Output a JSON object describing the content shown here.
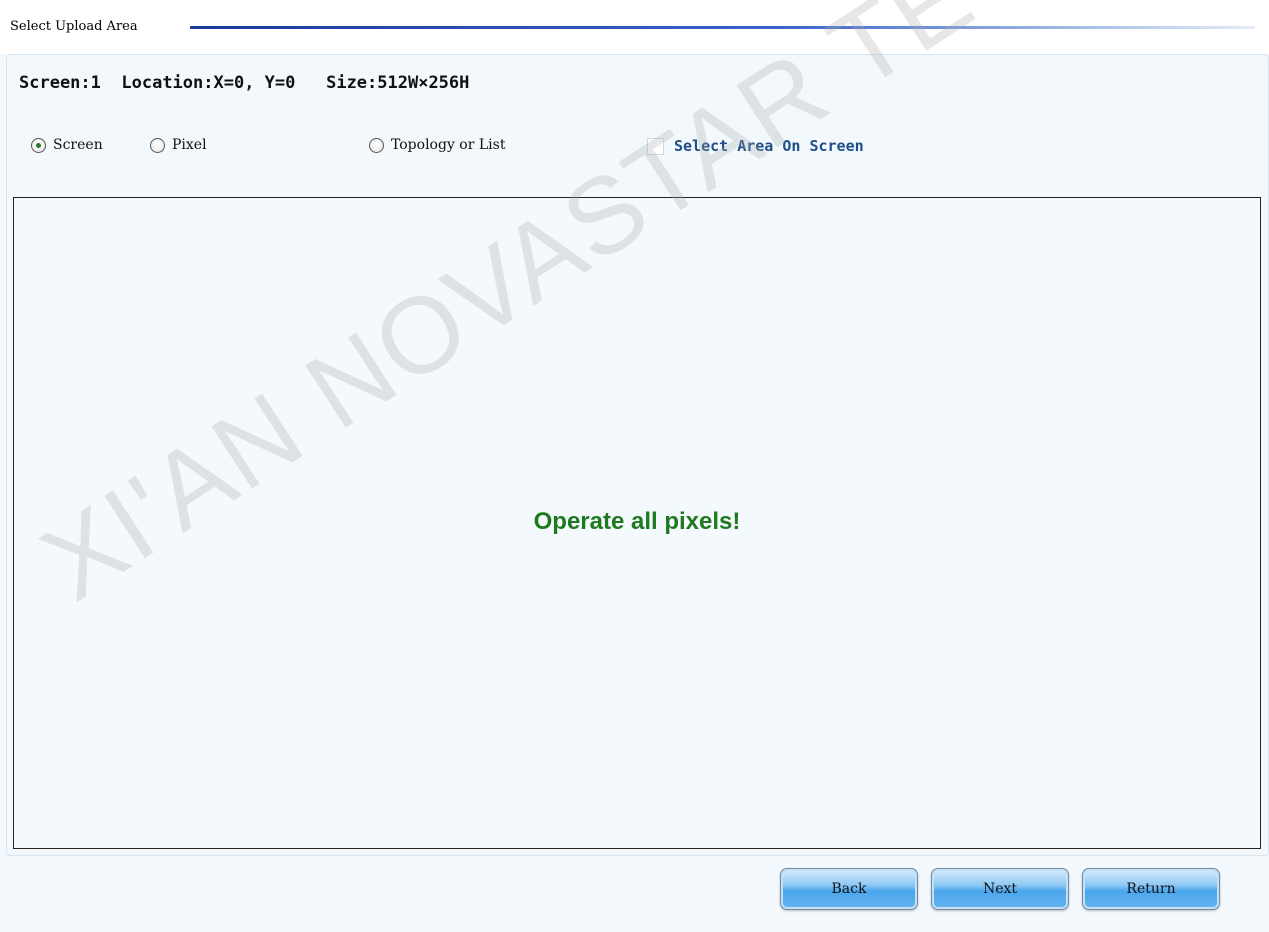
{
  "group": {
    "title": "Select Upload Area"
  },
  "info": {
    "screen": "Screen:1",
    "location": "Location:X=0, Y=0",
    "size": "Size:512W×256H"
  },
  "options": {
    "screen_label": "Screen",
    "pixel_label": "Pixel",
    "topology_label": "Topology or List",
    "select_area_label": "Select Area On Screen",
    "selected": "Screen",
    "select_area_checked": false
  },
  "display": {
    "message": "Operate all pixels!"
  },
  "buttons": {
    "back": "Back",
    "next": "Next",
    "return": "Return"
  },
  "watermark": {
    "text": "XI'AN NOVASTAR TECH CO., L."
  },
  "colors": {
    "message": "#1f7a1f",
    "checkbox_label": "#1d4f86",
    "header_line": "#1a3a9a",
    "button": "#4aa6ec"
  }
}
